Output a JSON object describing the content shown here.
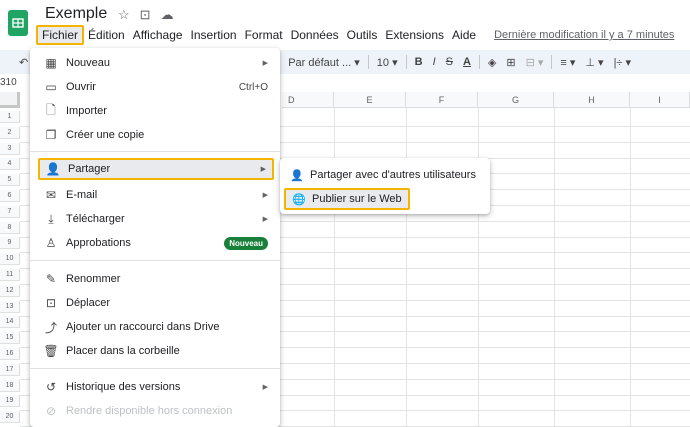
{
  "app": {
    "title": "Exemple",
    "name_box": "310"
  },
  "menubar": {
    "items": [
      "Fichier",
      "Édition",
      "Affichage",
      "Insertion",
      "Format",
      "Données",
      "Outils",
      "Extensions",
      "Aide"
    ],
    "last_modified": "Dernière modification il y a 7 minutes"
  },
  "toolbar": {
    "font": "Par défaut ...",
    "size": "10"
  },
  "columns": [
    "D",
    "E",
    "F",
    "G",
    "H",
    "I"
  ],
  "rows": [
    "1",
    "2",
    "3",
    "4",
    "5",
    "6",
    "7",
    "8",
    "9",
    "10",
    "11",
    "12",
    "13",
    "14",
    "15",
    "16",
    "17",
    "18",
    "19",
    "20"
  ],
  "file_menu": {
    "nouveau": "Nouveau",
    "ouvrir": "Ouvrir",
    "ouvrir_shortcut": "Ctrl+O",
    "importer": "Importer",
    "copie": "Créer une copie",
    "partager": "Partager",
    "email": "E-mail",
    "telecharger": "Télécharger",
    "approbations": "Approbations",
    "badge": "Nouveau",
    "renommer": "Renommer",
    "deplacer": "Déplacer",
    "raccourci": "Ajouter un raccourci dans Drive",
    "corbeille": "Placer dans la corbeille",
    "historique": "Historique des versions",
    "hors_connexion": "Rendre disponible hors connexion"
  },
  "share_submenu": {
    "partager_autres": "Partager avec d'autres utilisateurs",
    "publier": "Publier sur le Web"
  },
  "colors": {
    "highlight": "#f4b400",
    "brand": "#1fa463",
    "badge": "#188038"
  }
}
